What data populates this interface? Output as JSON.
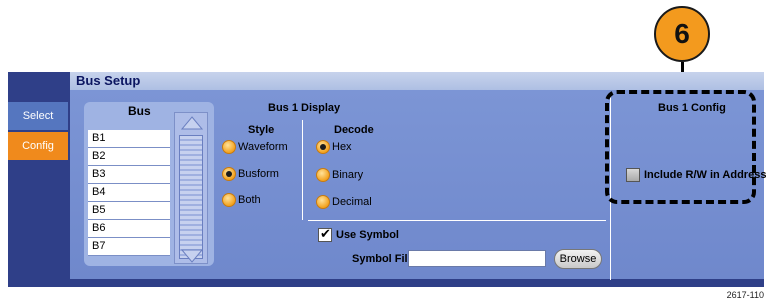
{
  "callout": {
    "number": "6"
  },
  "window": {
    "title": "Bus Setup"
  },
  "tabs": [
    {
      "label": "Select"
    },
    {
      "label": "Config"
    }
  ],
  "bus": {
    "header": "Bus",
    "items": [
      "B1",
      "B2",
      "B3",
      "B4",
      "B5",
      "B6",
      "B7"
    ]
  },
  "display": {
    "header": "Bus 1 Display",
    "style_header": "Style",
    "style_options": [
      "Waveform",
      "Busform",
      "Both"
    ],
    "style_selected": "Busform",
    "decode_header": "Decode",
    "decode_options": [
      "Hex",
      "Binary",
      "Decimal"
    ],
    "decode_selected": "Hex",
    "use_symbol_label": "Use Symbol",
    "use_symbol_checked": true,
    "symbol_file_label": "Symbol File",
    "symbol_file_value": "",
    "browse_label": "Browse"
  },
  "config": {
    "header": "Bus 1 Config",
    "include_rw_label": "Include R/W in Address",
    "include_rw_checked": false
  },
  "figure_code": "2617-110",
  "colors": {
    "callout": "#f39a1e",
    "tab_active": "#f08a1c",
    "panel": "#7c95d5",
    "window_frame": "#2f3f88"
  }
}
